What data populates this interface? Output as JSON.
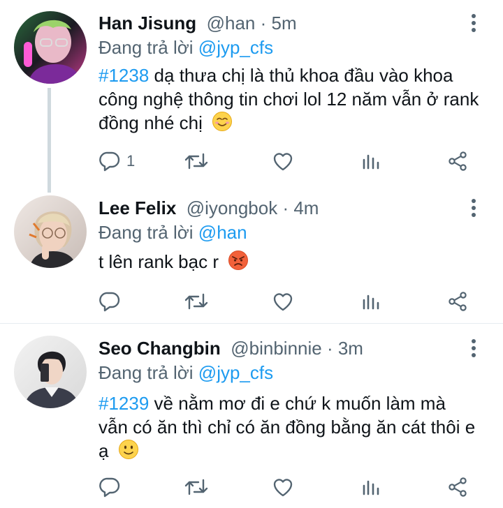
{
  "tweets": [
    {
      "name": "Han Jisung",
      "handle": "@han",
      "time": "5m",
      "replying_label": "Đang trả lời",
      "replying_to": "@jyp_cfs",
      "hashtag": "#1238",
      "text": "dạ thưa chị là thủ khoa đầu vào khoa công nghệ thông tin chơi lol 12 năm vẫn ở rank đồng nhé chị",
      "reply_count": "1"
    },
    {
      "name": "Lee Felix",
      "handle": "@iyongbok",
      "time": "4m",
      "replying_label": "Đang trả lời",
      "replying_to": "@han",
      "text": "t lên rank bạc r",
      "reply_count": ""
    },
    {
      "name": "Seo Changbin",
      "handle": "@binbinnie",
      "time": "3m",
      "replying_label": "Đang trả lời",
      "replying_to": "@jyp_cfs",
      "hashtag": "#1239",
      "text": "về nằm mơ đi e chứ k muốn làm mà vẫn có ăn thì chỉ có ăn đồng bằng ăn cát thôi e ạ",
      "reply_count": ""
    }
  ],
  "separator": " · ",
  "colors": {
    "link": "#1d9bf0",
    "secondary": "#536471",
    "icon": "#536471",
    "thread": "#cfd9de"
  },
  "icons": [
    "reply-icon",
    "retweet-icon",
    "like-icon",
    "analytics-icon",
    "share-icon",
    "more-options-icon"
  ]
}
